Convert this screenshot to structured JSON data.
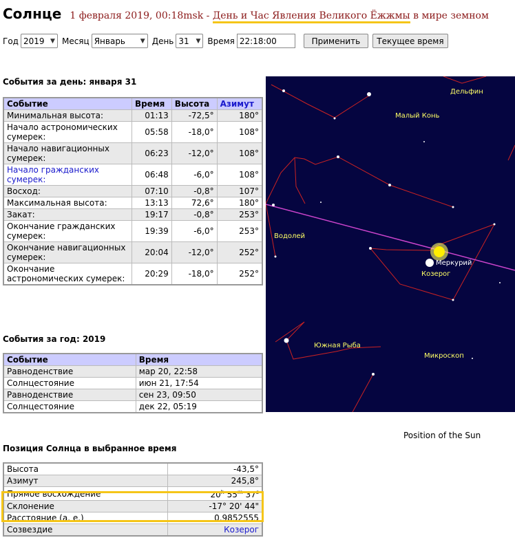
{
  "header": {
    "title": "Солнце",
    "date": "1 февраля 2019, 00:18msk",
    "sep": " - ",
    "holiday": "День и Час Явления Великого Ёжжмы",
    "suffix": " в мире земном"
  },
  "controls": {
    "year_label": "Год",
    "year_value": "2019",
    "month_label": "Месяц",
    "month_value": "Январь",
    "day_label": "День",
    "day_value": "31",
    "time_label": "Время",
    "time_value": "22:18:00",
    "apply_button": "Применить",
    "now_button": "Текущее время"
  },
  "day_events": {
    "title": "События за день: января 31",
    "headers": [
      "Событие",
      "Время",
      "Высота",
      "Азимут"
    ],
    "rows": [
      {
        "event": "Минимальная высота:",
        "time": "01:13",
        "alt": "-72,5°",
        "az": "180°"
      },
      {
        "event": "Начало астрономических сумерек:",
        "time": "05:58",
        "alt": "-18,0°",
        "az": "108°"
      },
      {
        "event": "Начало навигационных сумерек:",
        "time": "06:23",
        "alt": "-12,0°",
        "az": "108°"
      },
      {
        "event": "Начало гражданских сумерек:",
        "time": "06:48",
        "alt": "-6,0°",
        "az": "108°"
      },
      {
        "event": "Восход:",
        "time": "07:10",
        "alt": "-0,8°",
        "az": "107°"
      },
      {
        "event": "Максимальная высота:",
        "time": "13:13",
        "alt": "72,6°",
        "az": "180°"
      },
      {
        "event": "Закат:",
        "time": "19:17",
        "alt": "-0,8°",
        "az": "253°"
      },
      {
        "event": "Окончание гражданских сумерек:",
        "time": "19:39",
        "alt": "-6,0°",
        "az": "253°"
      },
      {
        "event": "Окончание навигационных сумерек:",
        "time": "20:04",
        "alt": "-12,0°",
        "az": "252°"
      },
      {
        "event": "Окончание астрономических сумерек:",
        "time": "20:29",
        "alt": "-18,0°",
        "az": "252°"
      }
    ]
  },
  "year_events": {
    "title": "События за год: 2019",
    "headers": [
      "Событие",
      "Время"
    ],
    "rows": [
      {
        "event": "Равноденствие",
        "time": "мар 20, 22:58"
      },
      {
        "event": "Солнцестояние",
        "time": "июн 21, 17:54"
      },
      {
        "event": "Равноденствие",
        "time": "сен 23, 09:50"
      },
      {
        "event": "Солнцестояние",
        "time": "дек 22, 05:19"
      }
    ]
  },
  "position": {
    "title": "Позиция Солнца в выбранное время",
    "altitude_label": "Высота",
    "altitude_value": "-43,5°",
    "azimuth_label": "Азимут",
    "azimuth_value": "245,8°",
    "ra_label": "Прямое восхождение",
    "ra_h": "20",
    "ra_m": "55",
    "ra_s": "37",
    "dec_label": "Склонение",
    "dec_value": "-17° 20' 44\"",
    "distance_label": "Расстояние (а. е.)",
    "distance_value": "0,9852555",
    "constellation_label": "Созвездие",
    "constellation_value": "Козерог"
  },
  "sky_map": {
    "labels": [
      "Дельфин",
      "Малый Конь",
      "Водолей",
      "Меркурий",
      "Козерог",
      "Южная Рыба",
      "Микроскоп"
    ],
    "caption": "Position of the Sun",
    "colors": {
      "background": "#050540",
      "lines": "#cc2222",
      "ecliptic": "#cc44cc",
      "labels": "#ffff66"
    }
  },
  "colors": {
    "accent_header": "#ccccff",
    "highlight": "#f5c518",
    "title_red": "#8b1a1a",
    "link": "#1a1acc"
  }
}
